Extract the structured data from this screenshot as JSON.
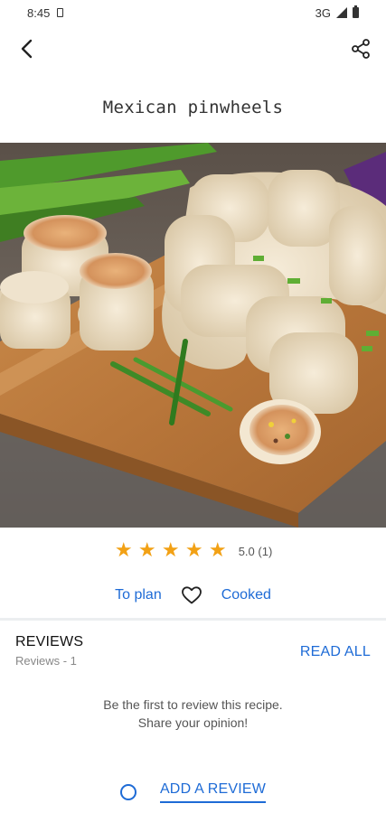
{
  "status_bar": {
    "time": "8:45",
    "network": "3G",
    "icons": [
      "sim-card-icon",
      "signal-icon",
      "battery-icon"
    ]
  },
  "app_bar": {
    "back_icon": "arrow-back-icon",
    "share_icon": "share-icon"
  },
  "recipe": {
    "title": "Mexican pinwheels",
    "image_icon": "recipe-photo"
  },
  "rating": {
    "stars": 5,
    "max_stars": 5,
    "summary": "5.0 (1)",
    "star_color": "#f2a115"
  },
  "actions": {
    "plan_label": "To plan",
    "favorite_icon": "heart-outline-icon",
    "cooked_label": "Cooked"
  },
  "reviews": {
    "title": "REVIEWS",
    "count_text": "Reviews - 1",
    "read_all_label": "READ ALL",
    "empty_message": "Be the first to review this recipe. Share your opinion!",
    "add_review_icon": "circle-outline-icon",
    "add_review_label": "ADD A REVIEW"
  },
  "colors": {
    "accent": "#1e6bd6",
    "star": "#f2a115",
    "divider": "#eceef0"
  }
}
